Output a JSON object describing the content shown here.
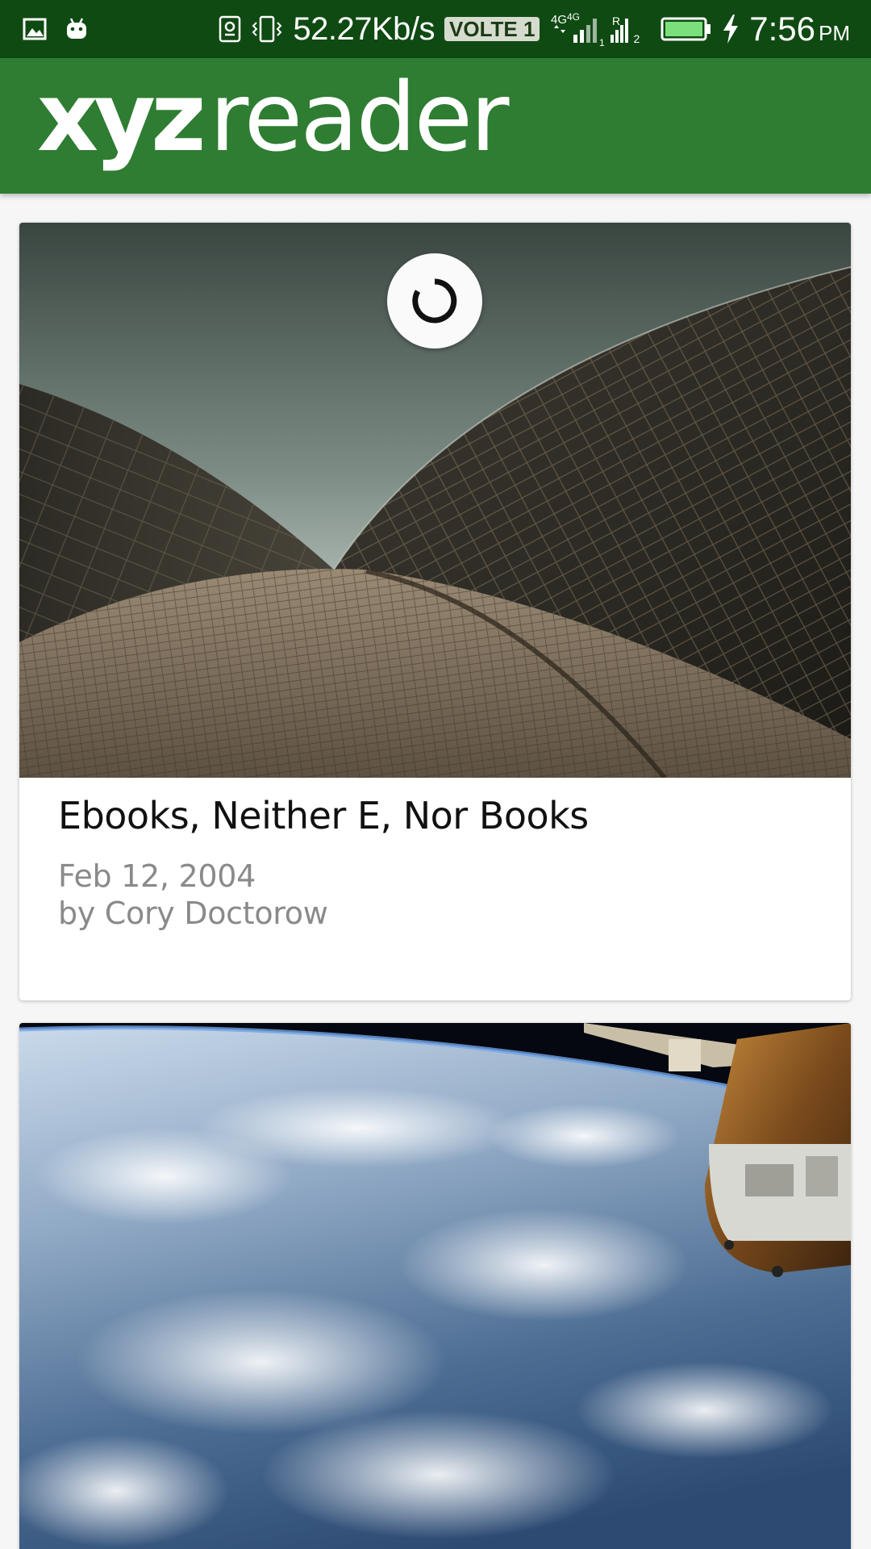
{
  "status_bar": {
    "net_speed": "52.27Kb/s",
    "volte_badge": "VOLTE 1",
    "network_1": "4G",
    "network_2": "4G",
    "sim1_label": "1",
    "sim2_roaming": "R",
    "sim2_label": "2",
    "time": "7:56",
    "ampm": "PM",
    "icons": [
      "image-notification-icon",
      "android-icon",
      "lock-screen-icon",
      "vibrate-icon",
      "signal-icon",
      "battery-icon",
      "charging-icon"
    ],
    "colors": {
      "background": "#0f4a12",
      "battery_fill": "#7be07b"
    }
  },
  "app_bar": {
    "logo_bold": "xyz",
    "logo_light": "reader",
    "color": "#2e7d32"
  },
  "articles": [
    {
      "title": "Ebooks, Neither E, Nor Books",
      "date": "Feb 12, 2004",
      "author": "by Cory Doctorow",
      "image": "opera-house-shells-photo"
    },
    {
      "title": "",
      "image": "earth-from-orbit-with-space-station-photo"
    }
  ],
  "loading": {
    "icon": "refresh-spinner-icon"
  }
}
